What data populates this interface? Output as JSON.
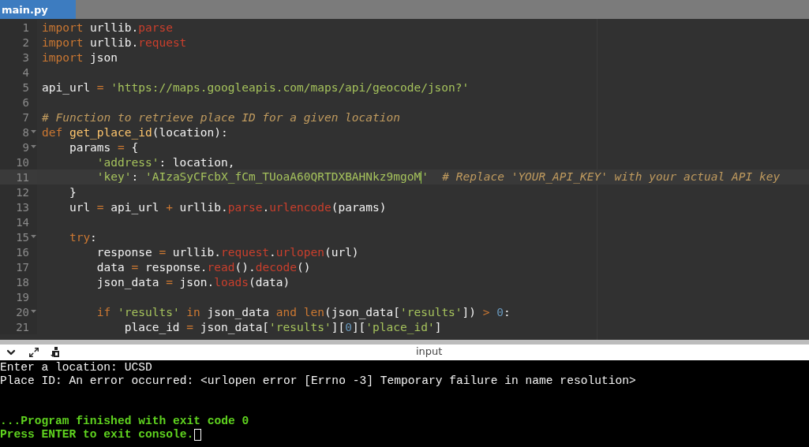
{
  "tabs": [
    {
      "label": "main.py",
      "selected": true
    }
  ],
  "editor": {
    "lines": [
      {
        "number": "1",
        "fold": false,
        "active": false,
        "tokens": [
          {
            "kind": "kw",
            "text": "import"
          },
          {
            "kind": "plain",
            "text": " urllib."
          },
          {
            "kind": "attr",
            "text": "parse"
          }
        ]
      },
      {
        "number": "2",
        "fold": false,
        "active": false,
        "tokens": [
          {
            "kind": "kw",
            "text": "import"
          },
          {
            "kind": "plain",
            "text": " urllib."
          },
          {
            "kind": "attr",
            "text": "request"
          }
        ]
      },
      {
        "number": "3",
        "fold": false,
        "active": false,
        "tokens": [
          {
            "kind": "kw",
            "text": "import"
          },
          {
            "kind": "plain",
            "text": " json"
          }
        ]
      },
      {
        "number": "4",
        "fold": false,
        "active": false
      },
      {
        "number": "5",
        "fold": false,
        "active": false,
        "tokens": [
          {
            "kind": "plain",
            "text": "api_url "
          },
          {
            "kind": "op",
            "text": "="
          },
          {
            "kind": "str",
            "text": " 'https://maps.googleapis.com/maps/api/geocode/json?'"
          }
        ]
      },
      {
        "number": "6",
        "fold": false,
        "active": false
      },
      {
        "number": "7",
        "fold": false,
        "active": false,
        "tokens": [
          {
            "kind": "comment",
            "text": "# Function to retrieve place ID for a given location"
          }
        ]
      },
      {
        "number": "8",
        "fold": true,
        "active": false,
        "tokens": [
          {
            "kind": "kw",
            "text": "def"
          },
          {
            "kind": "fn",
            "text": " get_place_id"
          },
          {
            "kind": "plain",
            "text": "(location):"
          }
        ]
      },
      {
        "number": "9",
        "fold": true,
        "active": false,
        "tokens": [
          {
            "kind": "plain",
            "text": "    params "
          },
          {
            "kind": "op",
            "text": "="
          },
          {
            "kind": "plain",
            "text": " {"
          }
        ]
      },
      {
        "number": "10",
        "fold": false,
        "active": false,
        "tokens": [
          {
            "kind": "str",
            "text": "        'address'"
          },
          {
            "kind": "plain",
            "text": ": location,"
          }
        ]
      },
      {
        "number": "11",
        "fold": false,
        "active": true,
        "tokens": [
          {
            "kind": "str",
            "text": "        'key'"
          },
          {
            "kind": "plain",
            "text": ": "
          },
          {
            "kind": "str",
            "text": "'AIzaSyCFcbX_fCm_TUoaA60QRTDXBAHNkz9mgoM"
          },
          {
            "kind": "caret"
          },
          {
            "kind": "str",
            "text": "'"
          },
          {
            "kind": "comment",
            "text": "  # Replace 'YOUR_API_KEY' with your actual API key"
          }
        ]
      },
      {
        "number": "12",
        "fold": false,
        "active": false,
        "tokens": [
          {
            "kind": "plain",
            "text": "    }"
          }
        ]
      },
      {
        "number": "13",
        "fold": false,
        "active": false,
        "tokens": [
          {
            "kind": "plain",
            "text": "    url "
          },
          {
            "kind": "op",
            "text": "="
          },
          {
            "kind": "plain",
            "text": " api_url "
          },
          {
            "kind": "op",
            "text": "+"
          },
          {
            "kind": "plain",
            "text": " urllib."
          },
          {
            "kind": "attr",
            "text": "parse"
          },
          {
            "kind": "plain",
            "text": "."
          },
          {
            "kind": "attr",
            "text": "urlencode"
          },
          {
            "kind": "plain",
            "text": "(params)"
          }
        ]
      },
      {
        "number": "14",
        "fold": false,
        "active": false
      },
      {
        "number": "15",
        "fold": true,
        "active": false,
        "tokens": [
          {
            "kind": "kw",
            "text": "    try"
          },
          {
            "kind": "plain",
            "text": ":"
          }
        ]
      },
      {
        "number": "16",
        "fold": false,
        "active": false,
        "tokens": [
          {
            "kind": "plain",
            "text": "        response "
          },
          {
            "kind": "op",
            "text": "="
          },
          {
            "kind": "plain",
            "text": " urllib."
          },
          {
            "kind": "attr",
            "text": "request"
          },
          {
            "kind": "plain",
            "text": "."
          },
          {
            "kind": "attr",
            "text": "urlopen"
          },
          {
            "kind": "plain",
            "text": "(url)"
          }
        ]
      },
      {
        "number": "17",
        "fold": false,
        "active": false,
        "tokens": [
          {
            "kind": "plain",
            "text": "        data "
          },
          {
            "kind": "op",
            "text": "="
          },
          {
            "kind": "plain",
            "text": " response."
          },
          {
            "kind": "attr",
            "text": "read"
          },
          {
            "kind": "plain",
            "text": "()."
          },
          {
            "kind": "attr",
            "text": "decode"
          },
          {
            "kind": "plain",
            "text": "()"
          }
        ]
      },
      {
        "number": "18",
        "fold": false,
        "active": false,
        "tokens": [
          {
            "kind": "plain",
            "text": "        json_data "
          },
          {
            "kind": "op",
            "text": "="
          },
          {
            "kind": "plain",
            "text": " json."
          },
          {
            "kind": "attr",
            "text": "loads"
          },
          {
            "kind": "plain",
            "text": "(data)"
          }
        ]
      },
      {
        "number": "19",
        "fold": false,
        "active": false
      },
      {
        "number": "20",
        "fold": true,
        "active": false,
        "tokens": [
          {
            "kind": "kw",
            "text": "        if"
          },
          {
            "kind": "str",
            "text": " 'results'"
          },
          {
            "kind": "kw",
            "text": " in"
          },
          {
            "kind": "plain",
            "text": " json_data "
          },
          {
            "kind": "kw",
            "text": "and"
          },
          {
            "kind": "kw",
            "text": " len"
          },
          {
            "kind": "plain",
            "text": "(json_data["
          },
          {
            "kind": "str",
            "text": "'results'"
          },
          {
            "kind": "plain",
            "text": "]) "
          },
          {
            "kind": "op",
            "text": ">"
          },
          {
            "kind": "num",
            "text": " 0"
          },
          {
            "kind": "plain",
            "text": ":"
          }
        ]
      },
      {
        "number": "21",
        "fold": false,
        "active": false,
        "tokens": [
          {
            "kind": "plain",
            "text": "            place_id "
          },
          {
            "kind": "op",
            "text": "="
          },
          {
            "kind": "plain",
            "text": " json_data["
          },
          {
            "kind": "str",
            "text": "'results'"
          },
          {
            "kind": "plain",
            "text": "]["
          },
          {
            "kind": "num",
            "text": "0"
          },
          {
            "kind": "plain",
            "text": "]["
          },
          {
            "kind": "str",
            "text": "'place_id'"
          },
          {
            "kind": "plain",
            "text": "]"
          }
        ]
      }
    ]
  },
  "console": {
    "title": "input",
    "lines": [
      {
        "kind": "output",
        "text": "Enter a location: UCSD"
      },
      {
        "kind": "output",
        "text": "Place ID: An error occurred: <urlopen error [Errno -3] Temporary failure in name resolution>"
      },
      {
        "kind": "status",
        "text": "...Program finished with exit code 0"
      },
      {
        "kind": "status",
        "text": "Press ENTER to exit console.",
        "cursor": true
      }
    ]
  }
}
